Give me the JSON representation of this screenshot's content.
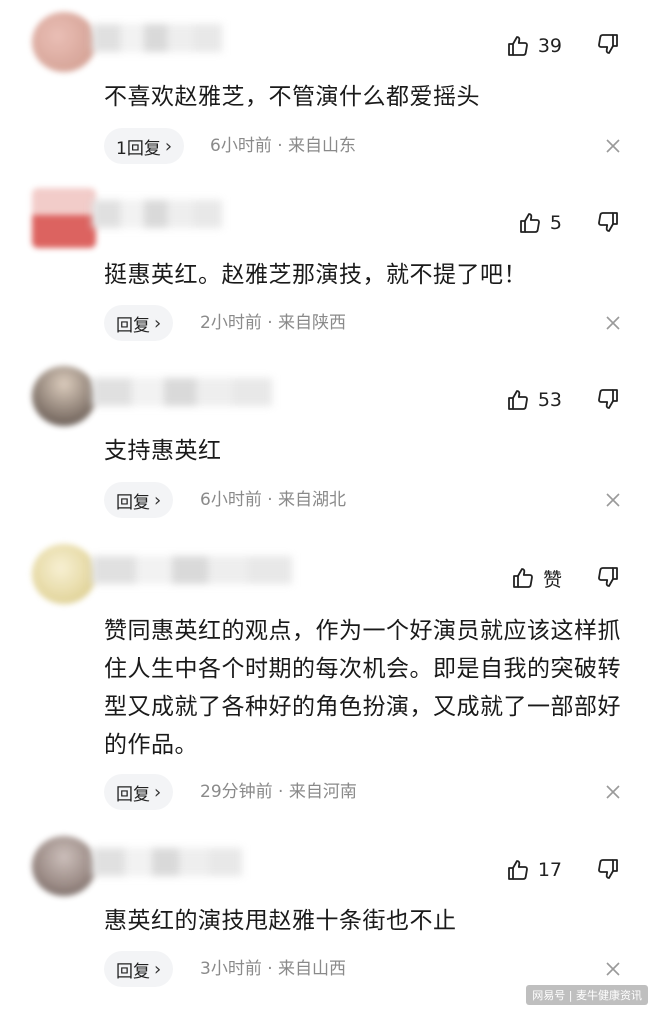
{
  "comments": [
    {
      "likes": "39",
      "text": "不喜欢赵雅芝，不管演什么都爱摇头",
      "reply_label": "1回复",
      "meta": "6小时前 · 来自山东",
      "avatar_color": "#d9a39a"
    },
    {
      "likes": "5",
      "text": "挺惠英红。赵雅芝那演技，就不提了吧！",
      "reply_label": "回复",
      "meta": "2小时前 · 来自陕西",
      "avatar_color": "#d9534f"
    },
    {
      "likes": "53",
      "text": "支持惠英红",
      "reply_label": "回复",
      "meta": "6小时前 · 来自湖北",
      "avatar_color": "#b5a08e"
    },
    {
      "likes": "赞",
      "text": "赞同惠英红的观点，作为一个好演员就应该这样抓住人生中各个时期的每次机会。即是自我的突破转型又成就了各种好的角色扮演，又成就了一部部好的作品。",
      "reply_label": "回复",
      "meta": "29分钟前 · 来自河南",
      "avatar_color": "#efe2b0"
    },
    {
      "likes": "17",
      "text": "惠英红的演技甩赵雅十条街也不止",
      "reply_label": "回复",
      "meta": "3小时前 · 来自山西",
      "avatar_color": "#a08c86"
    }
  ],
  "watermark": "网易号 | 麦牛健康资讯",
  "icons": {
    "like": "thumbs-up-icon",
    "dislike": "thumbs-down-icon",
    "close": "close-icon",
    "chevron": "chevron-right-icon"
  },
  "chevron_glyph": "›"
}
